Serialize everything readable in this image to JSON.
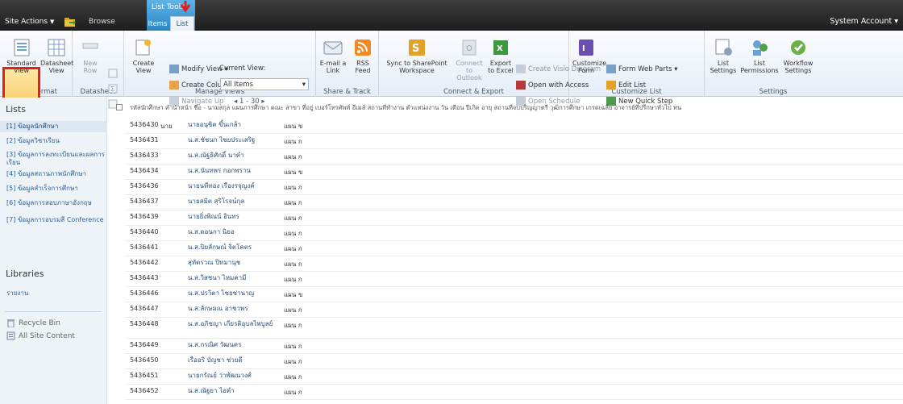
{
  "topbar": {
    "site_actions": "Site Actions",
    "browse": "Browse",
    "tools_label": "List Tools",
    "tab_items": "Items",
    "tab_list": "List",
    "system_account": "System Account"
  },
  "ribbon": {
    "view_format": {
      "standard": "Standard View",
      "datasheet": "Datasheet View",
      "label": "View Format"
    },
    "datasheet": {
      "new_row": "New Row",
      "label": "Datasheet"
    },
    "manage_views": {
      "create_view": "Create View",
      "modify_view": "Modify View",
      "create_column": "Create Column",
      "navigate_up": "Navigate Up",
      "current_view_label": "Current View:",
      "current_view_value": "All Items",
      "paging": "1 - 30",
      "label": "Manage Views"
    },
    "share_track": {
      "email_link": "E-mail a Link",
      "rss_feed": "RSS Feed",
      "label": "Share & Track"
    },
    "connect_export": {
      "sync": "Sync to SharePoint Workspace",
      "outlook": "Connect to Outlook",
      "excel": "Export to Excel",
      "visio": "Create Visio Diagram",
      "access": "Open with Access",
      "schedule": "Open Schedule",
      "label": "Connect & Export"
    },
    "customize_list": {
      "customize_form": "Customize Form",
      "form_web_parts": "Form Web Parts",
      "edit_list": "Edit List",
      "new_quick_step": "New Quick Step",
      "label": "Customize List"
    },
    "settings": {
      "list_settings": "List Settings",
      "list_permissions": "List Permissions",
      "workflow_settings": "Workflow Settings",
      "label": "Settings"
    }
  },
  "leftnav": {
    "lists_header": "Lists",
    "items": [
      {
        "label": "[1] ข้อมูลนักศึกษา",
        "selected": true
      },
      {
        "label": "[2] ข้อมูลวิชาเรียน",
        "selected": false
      },
      {
        "label": "[3] ข้อมูลการลงทะเบียนและผลการเรียน",
        "selected": false
      },
      {
        "label": "[4] ข้อมูลสถานภาพนักศึกษา",
        "selected": false
      },
      {
        "label": "[5] ข้อมูลสำเร็จการศึกษา",
        "selected": false
      },
      {
        "label": "[6] ข้อมูลการสอบภาษาอังกฤษ",
        "selected": false
      },
      {
        "label": "[7] ข้อมูลการอบรมสี Conference",
        "selected": false
      }
    ],
    "libraries_header": "Libraries",
    "reports": "รายงาน",
    "recycle_bin": "Recycle Bin",
    "all_site_content": "All Site Content"
  },
  "list": {
    "header_text": "รหัสนักศึกษา  คำนำหน้า  ชื่อ - นามสกุล        แผนการศึกษา  คณะ  สาขา  ที่อยู่  เบอร์โทรศัพท์  อีเมล์  สถานที่ทำงาน  ตำแหน่งงาน  วัน เดือน ปีเกิด  อายุ  สถานที่จบปริญญาตรี  วุฒิการศึกษา  เกรดเฉลี่ย  อาจารย์ที่ปรึกษาทั่วไป  ทน",
    "rows": [
      {
        "id": "5436430",
        "title": "นาย",
        "name": "นายอนุชิต ขึ้นเกล้า",
        "plan": "แผน ข"
      },
      {
        "id": "5436431",
        "title": "",
        "name": "น.ส.ชัชนก ไชยประเสริฐ",
        "plan": "แผน ก"
      },
      {
        "id": "5436433",
        "title": "",
        "name": "น.ส.ณัฐธิศักดิ์ นาคำ",
        "plan": "แผน ก"
      },
      {
        "id": "5436434",
        "title": "",
        "name": "น.ส.นันทพร กอกพราน",
        "plan": "แผน ข"
      },
      {
        "id": "5436436",
        "title": "",
        "name": "นายนทีทอง เรืองรจุญงค์",
        "plan": "แผน ก"
      },
      {
        "id": "5436437",
        "title": "",
        "name": "นายสมิต สุริโรจน์กุล",
        "plan": "แผน ก"
      },
      {
        "id": "5436439",
        "title": "",
        "name": "นายยิ่งพิณน์ อินทร",
        "plan": "แผน ก"
      },
      {
        "id": "5436440",
        "title": "",
        "name": "น.ส.ดอนกา นิยอ",
        "plan": "แผน ก"
      },
      {
        "id": "5436441",
        "title": "",
        "name": "น.ส.ปิยลักษณ์ จิตโคตร",
        "plan": "แผน ก"
      },
      {
        "id": "5436442",
        "title": "",
        "name": "สุทัตรวณ ปิทมานุช",
        "plan": "แผน ก"
      },
      {
        "id": "5436443",
        "title": "",
        "name": "น.ส.วิสชนา ไหมคามี",
        "plan": "แผน ก"
      },
      {
        "id": "5436446",
        "title": "",
        "name": "น.ส.ปรวิตา ไชยช่านาญ",
        "plan": "แผน ข"
      },
      {
        "id": "5436447",
        "title": "",
        "name": "น.ส.ลักษมณ อาชวพร",
        "plan": "แผน ก"
      },
      {
        "id": "5436448",
        "title": "",
        "name": "น.ส.อภิชญา เกียรติอุบลไพบูลย์",
        "plan": "แผน ก"
      },
      {
        "id": "5436449",
        "title": "",
        "name": "น.ส.กรณิศ วัฒนคร",
        "plan": "แผน ก"
      },
      {
        "id": "5436450",
        "title": "",
        "name": "เรืออริ บัญชา ช่วยดี",
        "plan": "แผน ก"
      },
      {
        "id": "5436451",
        "title": "",
        "name": "นายกรัณย์ ว่าพัฒนวงศ์",
        "plan": "แผน ก"
      },
      {
        "id": "5436452",
        "title": "",
        "name": "น.ส.ณัฐยา ไอคำ",
        "plan": "แผน ก"
      }
    ]
  },
  "colors": {
    "topbar": "#2a2a2a",
    "tools_tab": "#2a86c4",
    "highlight": "#e02020",
    "link": "#2b5f96"
  }
}
